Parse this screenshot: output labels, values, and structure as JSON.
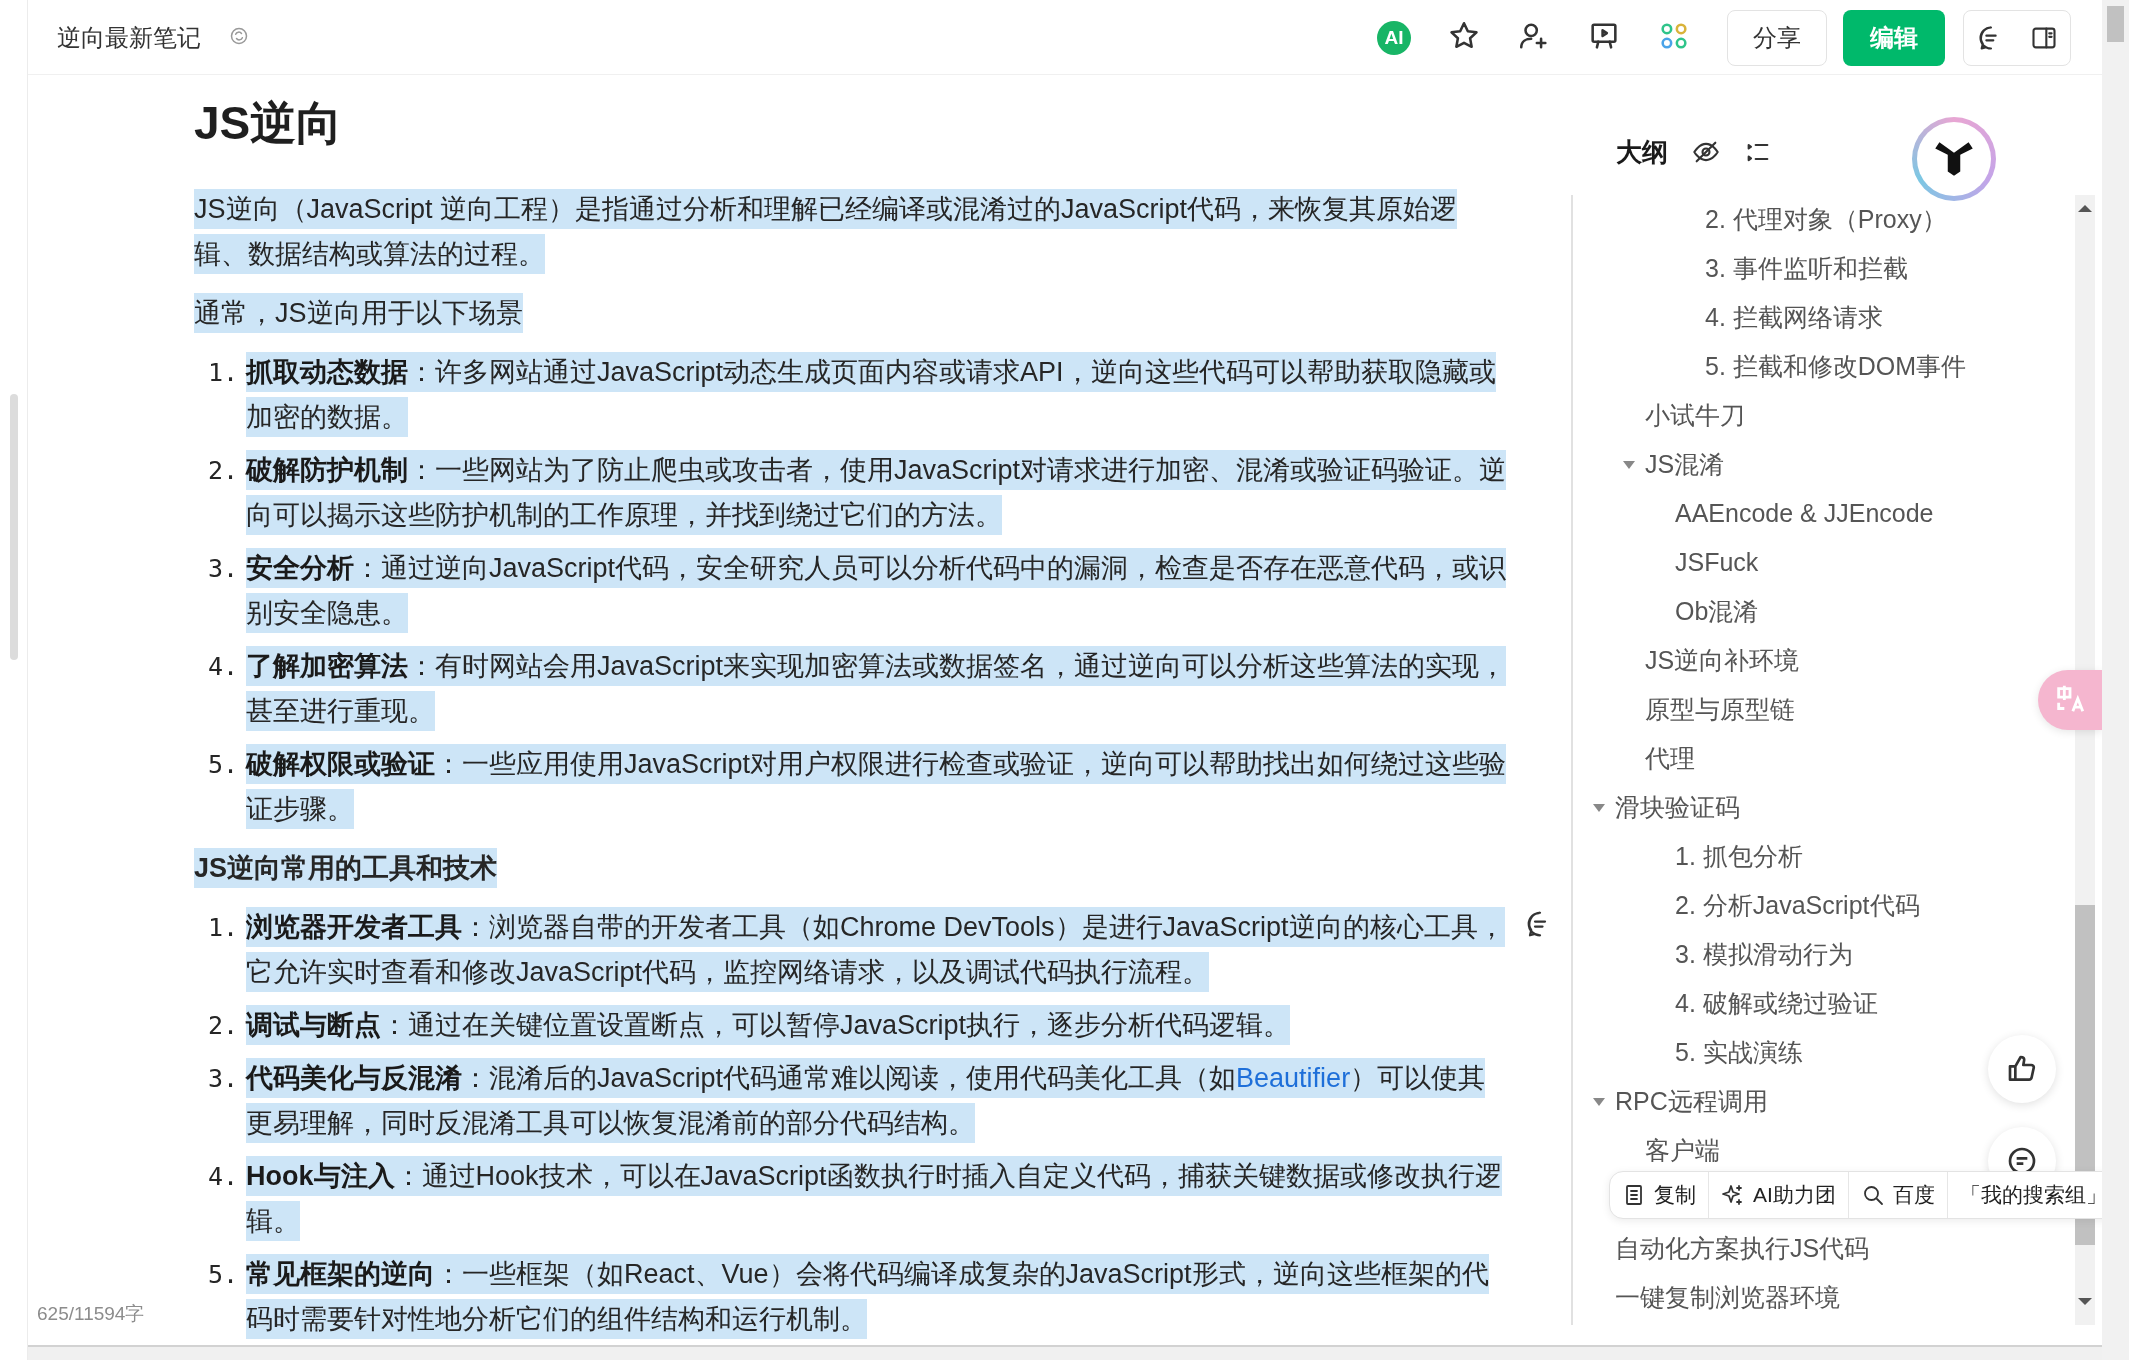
{
  "top_bar": {
    "title": "逆向最新笔记",
    "ai_badge": "AI",
    "share_button": "分享",
    "edit_button": "编辑"
  },
  "document": {
    "title": "JS逆向",
    "blocks": [
      {
        "kind": "paragraph",
        "selected": true,
        "text": "JS逆向（JavaScript 逆向工程）是指通过分析和理解已经编译或混淆过的JavaScript代码，来恢复其原始逻辑、数据结构或算法的过程。"
      },
      {
        "kind": "paragraph",
        "selected": true,
        "text": "通常，JS逆向用于以下场景"
      },
      {
        "kind": "list",
        "items": [
          {
            "marker": "1.",
            "selected": true,
            "text": "**抓取动态数据**：许多网站通过JavaScript动态生成页面内容或请求API，逆向这些代码可以帮助获取隐藏或加密的数据。"
          },
          {
            "marker": "2.",
            "selected": true,
            "text": "**破解防护机制**：一些网站为了防止爬虫或攻击者，使用JavaScript对请求进行加密、混淆或验证码验证。逆向可以揭示这些防护机制的工作原理，并找到绕过它们的方法。"
          },
          {
            "marker": "3.",
            "selected": true,
            "text": "**安全分析**：通过逆向JavaScript代码，安全研究人员可以分析代码中的漏洞，检查是否存在恶意代码，或识别安全隐患。"
          },
          {
            "marker": "4.",
            "selected": true,
            "text": "**了解加密算法**：有时网站会用JavaScript来实现加密算法或数据签名，通过逆向可以分析这些算法的实现，甚至进行重现。"
          },
          {
            "marker": "5.",
            "selected": true,
            "text": "**破解权限或验证**：一些应用使用JavaScript对用户权限进行检查或验证，逆向可以帮助找出如何绕过这些验证步骤。"
          }
        ]
      },
      {
        "kind": "heading",
        "selected": true,
        "text": "JS逆向常用的工具和技术"
      },
      {
        "kind": "list",
        "items": [
          {
            "marker": "1.",
            "selected": true,
            "comment": true,
            "text": "**浏览器开发者工具**：浏览器自带的开发者工具（如Chrome DevTools）是进行JavaScript逆向的核心工具，它允许实时查看和修改JavaScript代码，监控网络请求，以及调试代码执行流程。"
          },
          {
            "marker": "2.",
            "selected": true,
            "text": "**调试与断点**：通过在关键位置设置断点，可以暂停JavaScript执行，逐步分析代码逻辑。"
          },
          {
            "marker": "3.",
            "selected": true,
            "text": "**代码美化与反混淆**：混淆后的JavaScript代码通常难以阅读，使用代码美化工具（如",
            "link": "Beautifier",
            "text_after": "）可以使其更易理解，同时反混淆工具可以恢复混淆前的部分代码结构。"
          },
          {
            "marker": "4.",
            "selected": true,
            "text": "**Hook与注入**：通过Hook技术，可以在JavaScript函数执行时插入自定义代码，捕获关键数据或修改执行逻辑。"
          },
          {
            "marker": "5.",
            "selected": true,
            "text": "**常见框架的逆向**：一些框架（如React、Vue）会将代码编译成复杂的JavaScript形式，逆向这些框架的代码时需要针对性地分析它们的组件结构和运行机制。"
          }
        ]
      }
    ],
    "word_count": "625/11594字"
  },
  "outline": {
    "title": "大纲",
    "items": [
      {
        "children": [
          {
            "children": [
              {
                "label": "2. 代理对象（Proxy）",
                "kind": "numbered"
              },
              {
                "label": "3. 事件监听和拦截",
                "kind": "numbered"
              },
              {
                "label": "4. 拦截网络请求",
                "kind": "numbered"
              },
              {
                "label": "5. 拦截和修改DOM事件",
                "kind": "numbered"
              }
            ]
          },
          {
            "label": "小试牛刀"
          },
          {
            "label": "JS混淆",
            "expanded": true,
            "children": [
              {
                "label": "AAEncode & JJEncode"
              },
              {
                "label": "JSFuck"
              },
              {
                "label": "Ob混淆"
              }
            ]
          },
          {
            "label": "JS逆向补环境"
          },
          {
            "label": "原型与原型链"
          },
          {
            "label": "代理"
          }
        ]
      },
      {
        "label": "滑块验证码",
        "expanded": true,
        "children": [
          {
            "label": "1. 抓包分析",
            "kind": "numbered"
          },
          {
            "label": "2. 分析JavaScript代码",
            "kind": "numbered"
          },
          {
            "label": "3. 模拟滑动行为",
            "kind": "numbered"
          },
          {
            "label": "4. 破解或绕过验证",
            "kind": "numbered"
          },
          {
            "label": "5. 实战演练",
            "kind": "numbered"
          }
        ]
      },
      {
        "label": "RPC远程调用",
        "expanded": true,
        "children": [
          {
            "label": "客户端",
            "toolbar_below": true
          }
        ]
      },
      {
        "label": "自动化方案执行JS代码"
      },
      {
        "label": "一键复制浏览器环境"
      }
    ]
  },
  "selection_toolbar": [
    {
      "kind": "copy",
      "label": "复制"
    },
    {
      "kind": "ai",
      "label": "AI助力团"
    },
    {
      "kind": "search",
      "label": "百度"
    },
    {
      "kind": "group",
      "label": "「我的搜索组」"
    }
  ]
}
